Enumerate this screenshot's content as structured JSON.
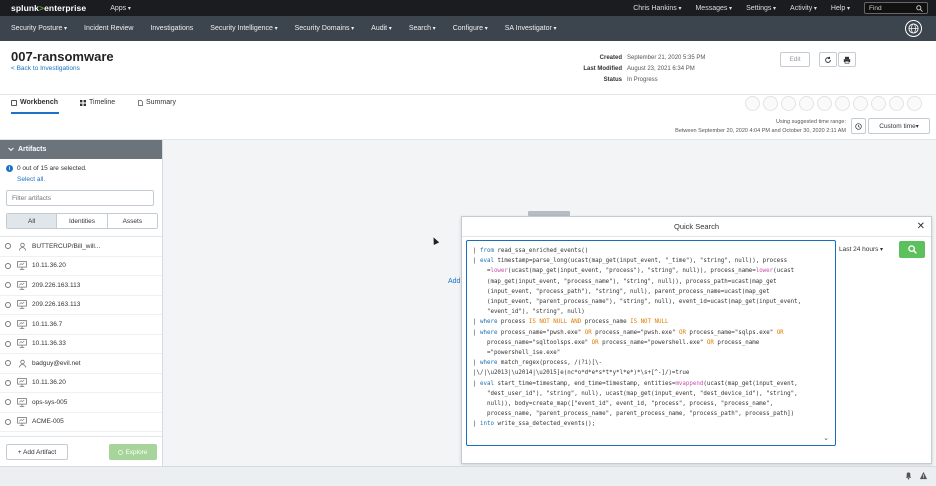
{
  "topbar": {
    "logo_brand": "splunk",
    "logo_gt": ">",
    "logo_product": "enterprise",
    "apps": "Apps",
    "user": "Chris Hankins",
    "messages": "Messages",
    "settings": "Settings",
    "activity": "Activity",
    "help": "Help",
    "find_placeholder": "Find"
  },
  "appnav": {
    "items": [
      "Security Posture",
      "Incident Review",
      "Investigations",
      "Security Intelligence",
      "Security Domains",
      "Audit",
      "Search",
      "Configure",
      "SA Investigator"
    ]
  },
  "investigation": {
    "title": "007-ransomware",
    "back": "< Back to Investigations",
    "created_key": "Created",
    "created_val": "September 21, 2020 5:35 PM",
    "modified_key": "Last Modified",
    "modified_val": "August 23, 2021 6:34 PM",
    "status_key": "Status",
    "status_val": "In Progress",
    "edit_label": "Edit"
  },
  "tabs": {
    "workbench": "Workbench",
    "timeline": "Timeline",
    "summary": "Summary"
  },
  "timerange": {
    "hint_line1": "Using suggested time range:",
    "hint_line2": "Between September 20, 2020 4:04 PM and October 30, 2020 2:11 AM",
    "button": "Custom time"
  },
  "sidebar": {
    "header": "Artifacts",
    "selection_info": "0 out of 15 are selected.",
    "select_all": "Select all.",
    "filter_placeholder": "Filter artifacts",
    "seg_all": "All",
    "seg_identities": "Identities",
    "seg_assets": "Assets",
    "artifacts": [
      {
        "label": "BUTTERCUP/Bill_will...",
        "type": "user-icon"
      },
      {
        "label": "10.11.36.20",
        "type": "monitor-icon"
      },
      {
        "label": "209.226.163.113",
        "type": "monitor-icon"
      },
      {
        "label": "209.226.163.113",
        "type": "monitor-icon"
      },
      {
        "label": "10.11.36.7",
        "type": "monitor-icon"
      },
      {
        "label": "10.11.36.33",
        "type": "monitor-icon"
      },
      {
        "label": "badguy@evil.net",
        "type": "user-icon"
      },
      {
        "label": "10.11.36.20",
        "type": "monitor-icon"
      },
      {
        "label": "ops-sys-005",
        "type": "monitor-icon"
      },
      {
        "label": "ACME-005",
        "type": "monitor-icon"
      }
    ],
    "add_artifact": "+ Add Artifact",
    "explore": "Explore"
  },
  "canvas": {
    "add_hint": "Add"
  },
  "quick_search": {
    "title": "Quick Search",
    "time_range": "Last 24 hours",
    "code_lines": [
      [
        [
          "| ",
          "t"
        ],
        [
          "from",
          "k"
        ],
        [
          " read_ssa_enriched_events()",
          "t"
        ]
      ],
      [
        [
          "| ",
          "t"
        ],
        [
          "eval",
          "k"
        ],
        [
          " timestamp=parse_long(ucast(map_get(input_event, \"_time\"), \"string\", null)), process",
          "t"
        ]
      ],
      [
        [
          "    =",
          "t"
        ],
        [
          "lower",
          "f"
        ],
        [
          "(ucast(map_get(input_event, \"process\"), \"string\", null)), process_name=",
          "t"
        ],
        [
          "lower",
          "f"
        ],
        [
          "(ucast",
          "t"
        ]
      ],
      [
        [
          "    (map_get(input_event, \"process_name\"), \"string\", null)), process_path=ucast(map_get",
          "t"
        ]
      ],
      [
        [
          "    (input_event, \"process_path\"), \"string\", null), parent_process_name=ucast(map_get",
          "t"
        ]
      ],
      [
        [
          "    (input_event, \"parent_process_name\"), \"string\", null), event_id=ucast(map_get(input_event,",
          "t"
        ]
      ],
      [
        [
          "    \"event_id\"), \"string\", null)",
          "t"
        ]
      ],
      [
        [
          "| ",
          "t"
        ],
        [
          "where",
          "k"
        ],
        [
          " process ",
          "t"
        ],
        [
          "IS NOT NULL AND",
          "o"
        ],
        [
          " process_name ",
          "t"
        ],
        [
          "IS NOT NULL",
          "o"
        ]
      ],
      [
        [
          "| ",
          "t"
        ],
        [
          "where",
          "k"
        ],
        [
          " process_name=\"pwsh.exe\" ",
          "t"
        ],
        [
          "OR",
          "o"
        ],
        [
          " process_name=\"pwsh.exe\" ",
          "t"
        ],
        [
          "OR",
          "o"
        ],
        [
          " process_name=\"sqlps.exe\" ",
          "t"
        ],
        [
          "OR",
          "o"
        ]
      ],
      [
        [
          "    process_name=\"sqltoolsps.exe\" ",
          "t"
        ],
        [
          "OR",
          "o"
        ],
        [
          " process_name=\"powershell.exe\" ",
          "t"
        ],
        [
          "OR",
          "o"
        ],
        [
          " process_name",
          "t"
        ]
      ],
      [
        [
          "    =\"powershell_ise.exe\"",
          "t"
        ]
      ],
      [
        [
          "| ",
          "t"
        ],
        [
          "where",
          "k"
        ],
        [
          " match_regex(process, /(?i)[\\-",
          "t"
        ]
      ],
      [
        [
          "|\\/|\\u2013|\\u2014|\\u2015]e(nc*o*d*e*s*t*y*l*e*)*\\s+[^-]/)=true",
          "t"
        ]
      ],
      [
        [
          "| ",
          "t"
        ],
        [
          "eval",
          "k"
        ],
        [
          " start_time=timestamp, end_time=timestamp, entities=",
          "t"
        ],
        [
          "mvappend",
          "f"
        ],
        [
          "(ucast(map_get(input_event,",
          "t"
        ]
      ],
      [
        [
          "    \"dest_user_id\"), \"string\", null), ucast(map_get(input_event, \"dest_device_id\"), \"string\",",
          "t"
        ]
      ],
      [
        [
          "    null)), body=create_map([\"event_id\", event_id, \"process\", process, \"process_name\",",
          "t"
        ]
      ],
      [
        [
          "    process_name, \"parent_process_name\", parent_process_name, \"process_path\", process_path])",
          "t"
        ]
      ],
      [
        [
          "| ",
          "t"
        ],
        [
          "into",
          "k"
        ],
        [
          " write_ssa_detected_events();",
          "t"
        ]
      ]
    ]
  },
  "colors": {
    "topbar_bg": "#1a1c20",
    "appnav_bg": "#3c444d",
    "accent_blue": "#1a73c4",
    "search_green": "#5cc05c",
    "explore_green_disabled": "#a6d49a"
  }
}
